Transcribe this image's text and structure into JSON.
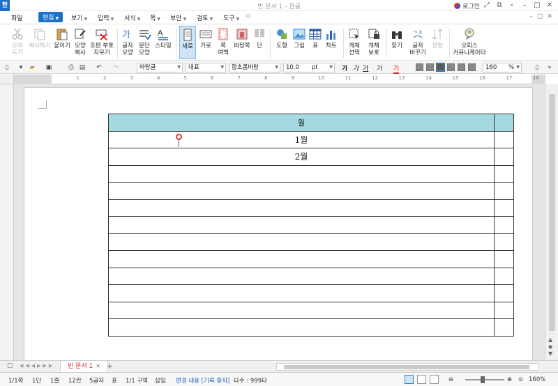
{
  "window": {
    "title": "빈 문서 1 - 한글",
    "app_logo": "한",
    "login": "로그인",
    "controls": [
      "restore-icon",
      "window-icon",
      "help-icon",
      "minimize-icon",
      "maximize-icon",
      "close-icon"
    ]
  },
  "menu": {
    "file": "파일",
    "edit": "편집",
    "view": "보기",
    "insert": "입력",
    "format": "서식",
    "page": "쪽",
    "security": "보안",
    "review": "검토",
    "tools": "도구",
    "right_icons": [
      "minimize-icon",
      "restore-icon",
      "close-icon"
    ]
  },
  "ribbon": {
    "cut": [
      "오려",
      "두기"
    ],
    "copy": "복사하기",
    "paste": "붙이기",
    "copy_format": [
      "모양",
      "복사"
    ],
    "clear_format": [
      "조판 부호",
      "지우기"
    ],
    "char_shape": [
      "글자",
      "모양"
    ],
    "para_shape": [
      "문단",
      "모양"
    ],
    "style": "스타일",
    "vertical": "세로",
    "horizontal": "가로",
    "page_margin": [
      "쪽",
      "여백"
    ],
    "background": "바탕쪽",
    "columns": "단",
    "shapes": "도형",
    "picture": "그림",
    "table": "표",
    "chart": "차트",
    "object_select": [
      "개체",
      "선택"
    ],
    "object_protect": [
      "개체",
      "보호"
    ],
    "find": "찾기",
    "replace": [
      "글자",
      "바꾸기"
    ],
    "sort": "정렬",
    "office": [
      "오피스",
      "커뮤니케이터"
    ]
  },
  "format_toolbar": {
    "style_combo": "바탕글",
    "lang_combo": "대표",
    "font_combo": "함초롬바탕",
    "size_value": "10.0",
    "size_unit": "pt",
    "bold": "가",
    "italic": "가",
    "underline": "가",
    "strike": "가",
    "color": "가",
    "zoom_value": "160",
    "zoom_unit": "%"
  },
  "ruler": {
    "ticks": [
      "1",
      "2",
      "3",
      "4",
      "5",
      "6",
      "7",
      "8",
      "9",
      "10",
      "11",
      "12",
      "13",
      "14",
      "15",
      "16",
      "17",
      "18"
    ]
  },
  "document": {
    "header": [
      "월",
      ""
    ],
    "rows": [
      [
        "1월",
        ""
      ],
      [
        "2월",
        ""
      ],
      [
        "",
        ""
      ],
      [
        "",
        ""
      ],
      [
        "",
        ""
      ],
      [
        "",
        ""
      ],
      [
        "",
        ""
      ],
      [
        "",
        ""
      ],
      [
        "",
        ""
      ],
      [
        "",
        ""
      ],
      [
        "",
        ""
      ],
      [
        "",
        ""
      ]
    ],
    "header_color": "#a3d9df"
  },
  "tabs": {
    "active": "빈 문서 1",
    "add": "+"
  },
  "status": {
    "page": "1/1쪽",
    "section": "1단",
    "line": "1줄",
    "col": "12칸",
    "chars": "5글자",
    "object": "표",
    "area": "1/1 구역",
    "mode": "삽입",
    "track": "변경 내용 [기록 중지]",
    "typing": "타수 : 999타",
    "zoom": "160%"
  },
  "colors": {
    "accent": "#1a73c8",
    "table_header": "#a3d9df",
    "tab_text": "#d03030"
  }
}
